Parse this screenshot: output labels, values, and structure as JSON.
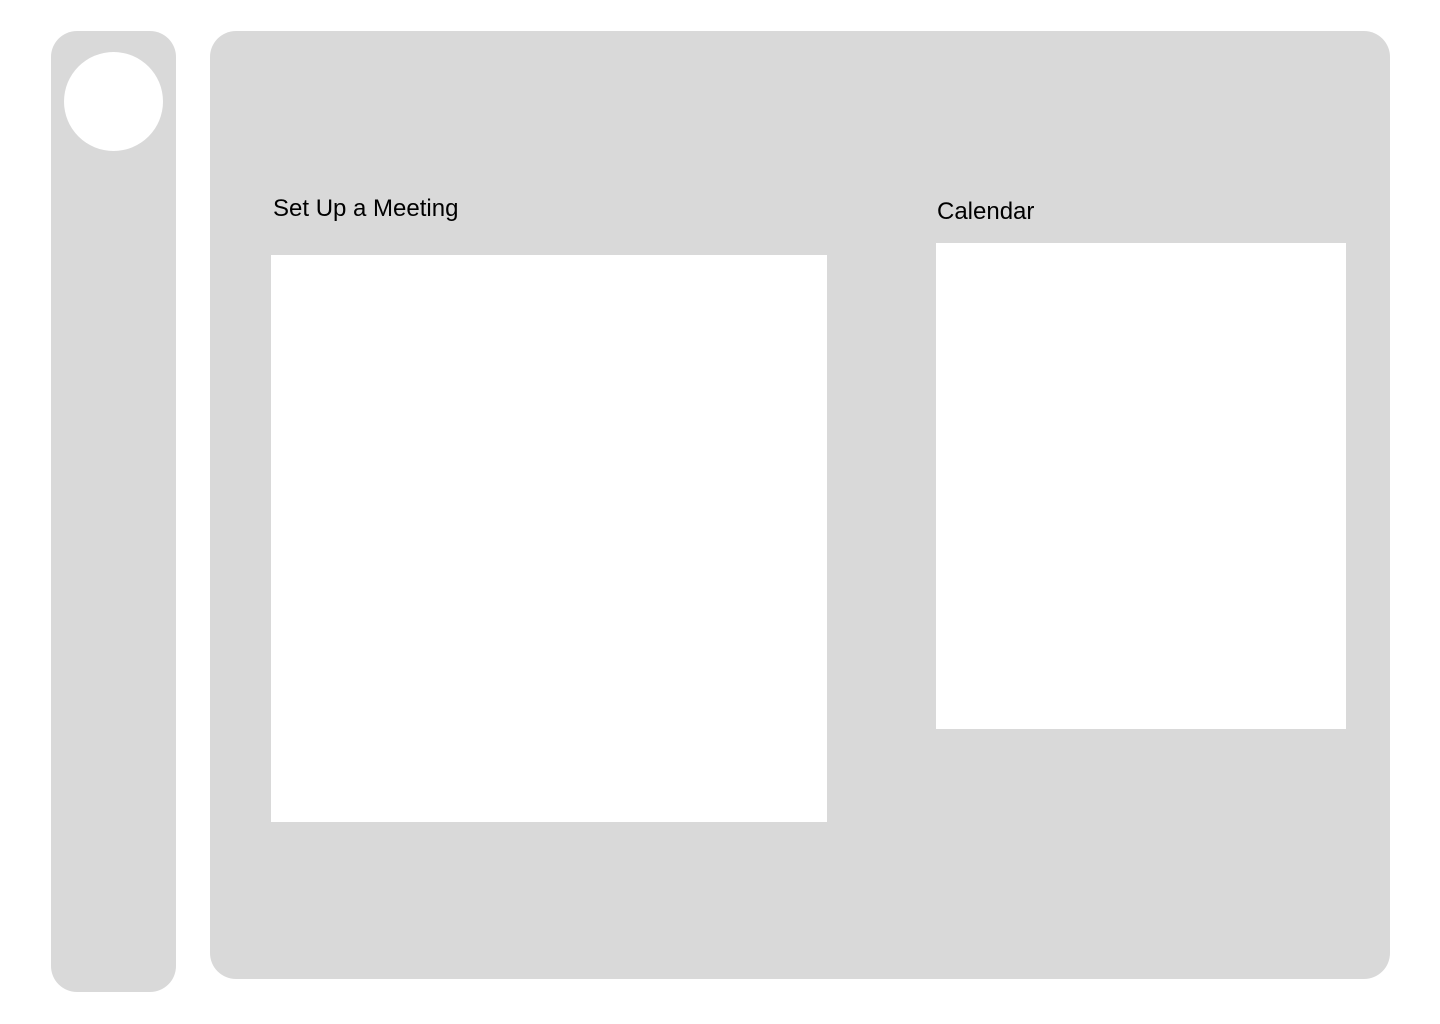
{
  "meeting": {
    "title": "Set Up a Meeting"
  },
  "calendar": {
    "title": "Calendar"
  },
  "colors": {
    "panel_background": "#d9d9d9",
    "content_background": "#ffffff",
    "text": "#000000"
  }
}
